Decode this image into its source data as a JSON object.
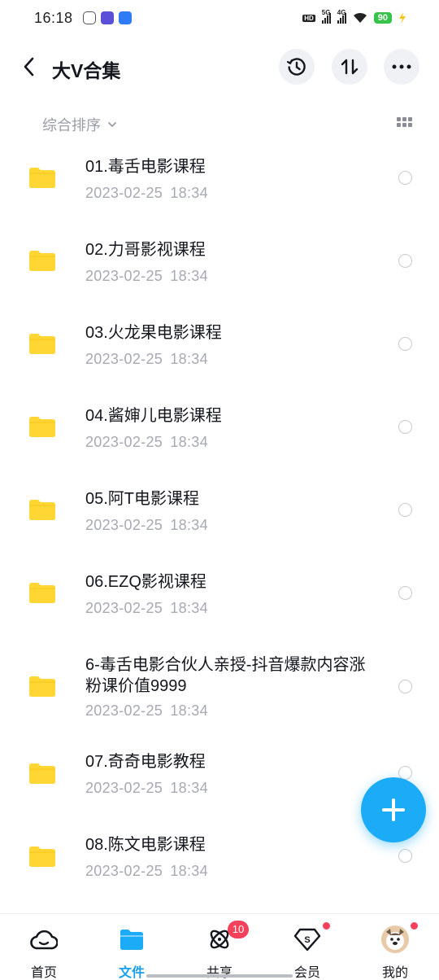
{
  "status_bar": {
    "time": "16:18",
    "net_hd": "HD",
    "net_5g": "5G",
    "net_4g": "4G",
    "battery": "90"
  },
  "header": {
    "title": "大V合集"
  },
  "sort": {
    "label": "综合排序"
  },
  "files": [
    {
      "name": "01.毒舌电影课程",
      "date": "2023-02-25  18:34"
    },
    {
      "name": "02.力哥影视课程",
      "date": "2023-02-25  18:34"
    },
    {
      "name": "03.火龙果电影课程",
      "date": "2023-02-25  18:34"
    },
    {
      "name": "04.酱婶儿电影课程",
      "date": "2023-02-25  18:34"
    },
    {
      "name": "05.阿T电影课程",
      "date": "2023-02-25  18:34"
    },
    {
      "name": "06.EZQ影视课程",
      "date": "2023-02-25  18:34"
    },
    {
      "name": "6-毒舌电影合伙人亲授-抖音爆款内容涨粉课价值9999",
      "date": "2023-02-25  18:34"
    },
    {
      "name": "07.奇奇电影教程",
      "date": "2023-02-25  18:34"
    },
    {
      "name": "08.陈文电影课程",
      "date": "2023-02-25  18:34"
    }
  ],
  "bottom_nav": {
    "items": [
      {
        "label": "首页",
        "icon": "cloud-home-icon"
      },
      {
        "label": "文件",
        "icon": "folder-icon",
        "active": true
      },
      {
        "label": "共享",
        "icon": "share-atom-icon"
      },
      {
        "label": "会员",
        "icon": "vip-diamond-icon"
      },
      {
        "label": "我的",
        "icon": "avatar-icon"
      }
    ],
    "share_badge": "10"
  },
  "colors": {
    "accent": "#1cacf7",
    "folder": "#ffd633",
    "badge": "#f5425a"
  }
}
